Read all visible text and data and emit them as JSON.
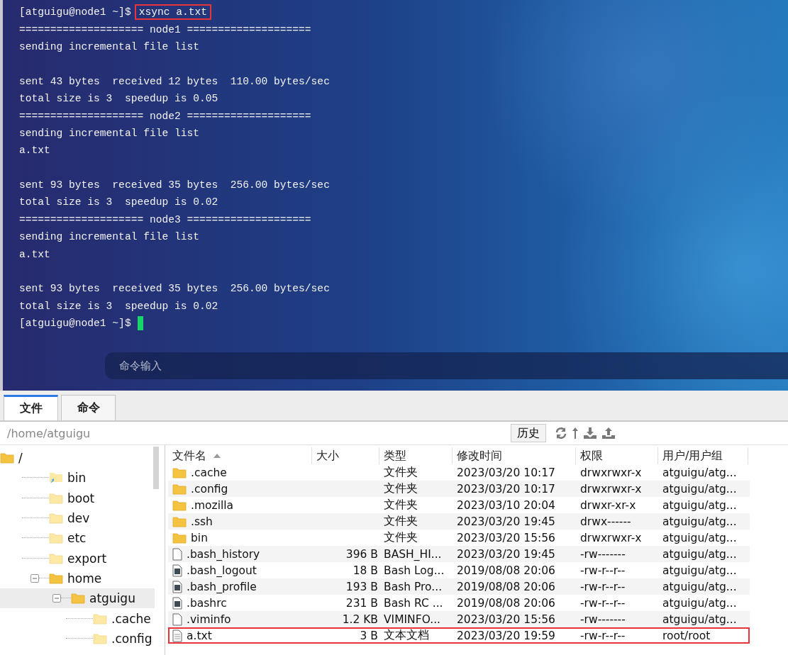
{
  "terminal": {
    "lines": [
      {
        "kind": "command",
        "prompt": "[atguigu@node1 ~]$",
        "command": "xsync a.txt",
        "highlighted": true
      },
      {
        "kind": "output",
        "text": "==================== node1 ===================="
      },
      {
        "kind": "output",
        "text": "sending incremental file list"
      },
      {
        "kind": "blank"
      },
      {
        "kind": "output",
        "text": "sent 43 bytes  received 12 bytes  110.00 bytes/sec"
      },
      {
        "kind": "output",
        "text": "total size is 3  speedup is 0.05"
      },
      {
        "kind": "output",
        "text": "==================== node2 ===================="
      },
      {
        "kind": "output",
        "text": "sending incremental file list"
      },
      {
        "kind": "output",
        "text": "a.txt"
      },
      {
        "kind": "blank"
      },
      {
        "kind": "output",
        "text": "sent 93 bytes  received 35 bytes  256.00 bytes/sec"
      },
      {
        "kind": "output",
        "text": "total size is 3  speedup is 0.02"
      },
      {
        "kind": "output",
        "text": "==================== node3 ===================="
      },
      {
        "kind": "output",
        "text": "sending incremental file list"
      },
      {
        "kind": "output",
        "text": "a.txt"
      },
      {
        "kind": "blank"
      },
      {
        "kind": "output",
        "text": "sent 93 bytes  received 35 bytes  256.00 bytes/sec"
      },
      {
        "kind": "output",
        "text": "total size is 3  speedup is 0.02"
      },
      {
        "kind": "prompt",
        "prompt": "[atguigu@node1 ~]$",
        "cursor": true
      }
    ],
    "command_input": {
      "placeholder": "命令输入"
    }
  },
  "tabs": [
    {
      "label": "文件",
      "selected": true
    },
    {
      "label": "命令",
      "selected": false
    }
  ],
  "path_bar": {
    "path": "/home/atguigu",
    "history_button": "历史"
  },
  "tree": {
    "label": "/",
    "kind": "folder",
    "children": [
      {
        "label": "bin",
        "kind": "link",
        "selected": false
      },
      {
        "label": "boot",
        "kind": "folder",
        "selected": false
      },
      {
        "label": "dev",
        "kind": "folder",
        "selected": false
      },
      {
        "label": "etc",
        "kind": "folder",
        "selected": false
      },
      {
        "label": "export",
        "kind": "folder",
        "selected": false
      },
      {
        "label": "home",
        "kind": "folder",
        "expanded": true,
        "selected": false,
        "children": [
          {
            "label": "atguigu",
            "kind": "folder",
            "expanded": true,
            "selected": true,
            "children": [
              {
                "label": ".cache",
                "kind": "folder",
                "selected": false
              },
              {
                "label": ".config",
                "kind": "folder",
                "selected": false
              }
            ]
          }
        ]
      }
    ]
  },
  "files": {
    "columns": [
      "文件名",
      "大小",
      "类型",
      "修改时间",
      "权限",
      "用户/用户组"
    ],
    "rows": [
      {
        "kind": "folder",
        "name": ".cache",
        "type": "文件夹",
        "modified": "2023/03/20 10:17",
        "permissions": "drwxrwxr-x",
        "owner": "atguigu/atg...",
        "highlighted": false
      },
      {
        "kind": "folder",
        "name": ".config",
        "type": "文件夹",
        "modified": "2023/03/20 10:17",
        "permissions": "drwxrwxr-x",
        "owner": "atguigu/atg...",
        "highlighted": false
      },
      {
        "kind": "folder",
        "name": ".mozilla",
        "type": "文件夹",
        "modified": "2023/03/10 20:04",
        "permissions": "drwxr-xr-x",
        "owner": "atguigu/atg...",
        "highlighted": false
      },
      {
        "kind": "folder",
        "name": ".ssh",
        "type": "文件夹",
        "modified": "2023/03/20 19:45",
        "permissions": "drwx------",
        "owner": "atguigu/atg...",
        "highlighted": false
      },
      {
        "kind": "folder",
        "name": "bin",
        "type": "文件夹",
        "modified": "2023/03/20 15:56",
        "permissions": "drwxrwxr-x",
        "owner": "atguigu/atg...",
        "highlighted": false
      },
      {
        "kind": "file",
        "name": ".bash_history",
        "size": "396 B",
        "type": "BASH_HI...",
        "modified": "2023/03/20 19:45",
        "permissions": "-rw-------",
        "owner": "atguigu/atg...",
        "highlighted": false
      },
      {
        "kind": "script",
        "name": ".bash_logout",
        "size": "18 B",
        "type": "Bash Log...",
        "modified": "2019/08/08 20:06",
        "permissions": "-rw-r--r--",
        "owner": "atguigu/atg...",
        "highlighted": false
      },
      {
        "kind": "script",
        "name": ".bash_profile",
        "size": "193 B",
        "type": "Bash Pro...",
        "modified": "2019/08/08 20:06",
        "permissions": "-rw-r--r--",
        "owner": "atguigu/atg...",
        "highlighted": false
      },
      {
        "kind": "script",
        "name": ".bashrc",
        "size": "231 B",
        "type": "Bash RC ...",
        "modified": "2019/08/08 20:06",
        "permissions": "-rw-r--r--",
        "owner": "atguigu/atg...",
        "highlighted": false
      },
      {
        "kind": "file",
        "name": ".viminfo",
        "size": "1.2 KB",
        "type": "VIMINFO...",
        "modified": "2023/03/20 15:56",
        "permissions": "-rw-------",
        "owner": "atguigu/atg...",
        "highlighted": false
      },
      {
        "kind": "text",
        "name": "a.txt",
        "size": "3 B",
        "type": "文本文档",
        "modified": "2023/03/20 19:59",
        "permissions": "-rw-r--r--",
        "owner": "root/root",
        "highlighted": true
      }
    ]
  }
}
